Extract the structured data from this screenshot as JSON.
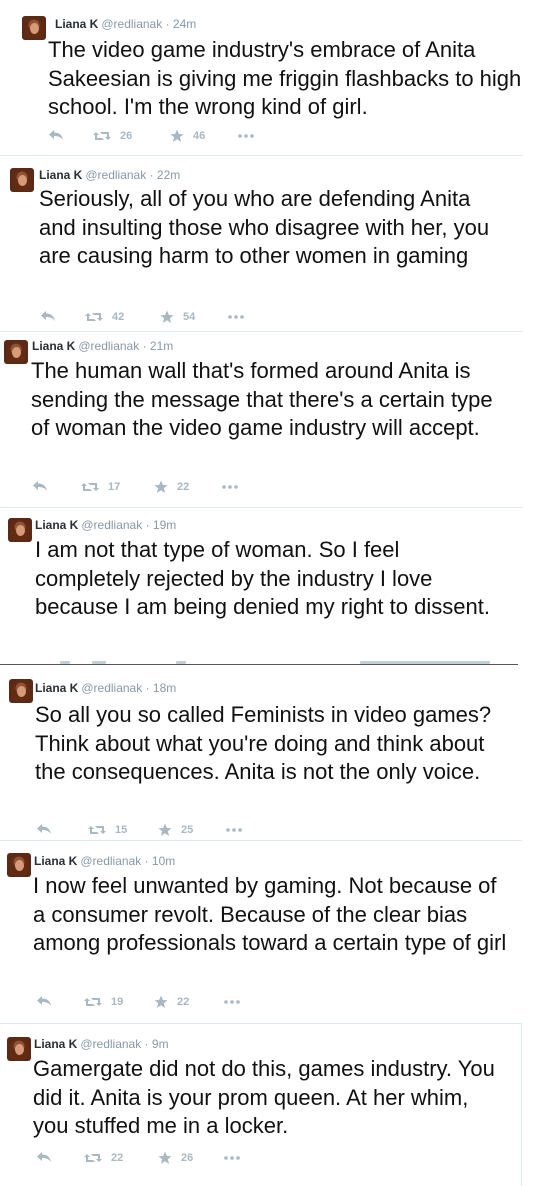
{
  "user": {
    "name": "Liana K",
    "handle": "@redlianak"
  },
  "separator": "·",
  "tweets": [
    {
      "time": "24m",
      "text": "The video game industry's embrace of Anita Sakeesian is giving me friggin flashbacks to high school. I'm the wrong kind of girl.",
      "retweets": "26",
      "favorites": "46"
    },
    {
      "time": "22m",
      "text": "Seriously,  all of you who are defending Anita and insulting those who disagree with her, you are causing harm to other women in gaming",
      "retweets": "42",
      "favorites": "54"
    },
    {
      "time": "21m",
      "text": "The human wall that's formed around Anita is sending the message that there's a certain type of woman the video game industry will accept.",
      "retweets": "17",
      "favorites": "22"
    },
    {
      "time": "19m",
      "text": "I am not that type of woman.  So I feel completely rejected by the industry I love because I am being denied my right to dissent.",
      "retweets": "",
      "favorites": ""
    },
    {
      "time": "18m",
      "text": "So all you so called Feminists in video games?  Think about what you're doing and think about the consequences. Anita is not the only voice.",
      "retweets": "15",
      "favorites": "25"
    },
    {
      "time": "10m",
      "text": "I now feel unwanted by gaming. Not because of a consumer revolt. Because of the clear bias among professionals toward a certain type of girl",
      "retweets": "19",
      "favorites": "22"
    },
    {
      "time": "9m",
      "text": "Gamergate did not do this, games industry. You did it.  Anita is your prom queen. At her whim, you stuffed me in a locker.",
      "retweets": "22",
      "favorites": "26"
    }
  ]
}
